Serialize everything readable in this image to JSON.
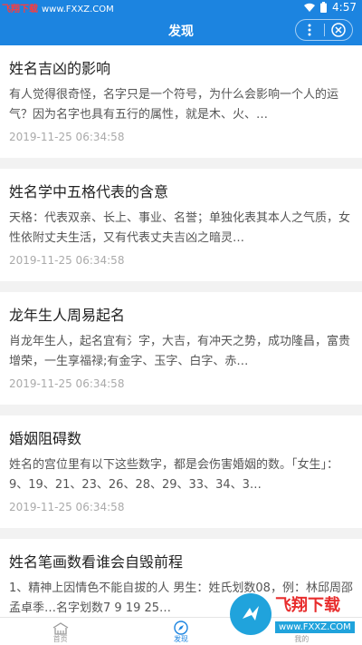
{
  "status": {
    "watermark_brand": "飞翔下载",
    "watermark_url": "www.FXXZ.COM",
    "time": "4:57"
  },
  "header": {
    "title": "发现"
  },
  "articles": [
    {
      "title": "姓名吉凶的影响",
      "excerpt": "有人觉得很奇怪，名字只是一个符号，为什么会影响一个人的运气？因为名字也具有五行的属性，就是木、火、…",
      "date": "2019-11-25 06:34:58"
    },
    {
      "title": "姓名学中五格代表的含意",
      "excerpt": "天格：代表双亲、长上、事业、名誉；单独化表其本人之气质，女性依附丈夫生活，又有代表丈夫吉凶之暗灵…",
      "date": "2019-11-25 06:34:58"
    },
    {
      "title": "龙年生人周易起名",
      "excerpt": "肖龙年生人，起名宜有氵字，大吉，有冲天之势，成功隆昌，富贵增荣，一生享福禄;有金字、玉字、白字、赤…",
      "date": "2019-11-25 06:34:58"
    },
    {
      "title": "婚姻阻碍数",
      "excerpt": "姓名的宫位里有以下这些数字，都是会伤害婚姻的数。「女生」：9、19、21、23、26、28、29、33、34、3…",
      "date": "2019-11-25 06:34:58"
    },
    {
      "title": "姓名笔画数看谁会自毁前程",
      "excerpt": "1、精神上因情色不能自拔的人 男生：姓氏划数08，例：林邱周邵孟卓季…名字划数7 9 19 25…",
      "date": ""
    }
  ],
  "tabs": [
    {
      "label": "首页",
      "icon": "home-icon",
      "active": false
    },
    {
      "label": "发现",
      "icon": "compass-icon",
      "active": true
    },
    {
      "label": "我的",
      "icon": "user-icon",
      "active": false
    }
  ],
  "watermark": {
    "main": "飞翔下载",
    "url": "www.FXXZ.COM"
  },
  "colors": {
    "primary": "#1c84e0",
    "background": "#f2f2f2"
  }
}
